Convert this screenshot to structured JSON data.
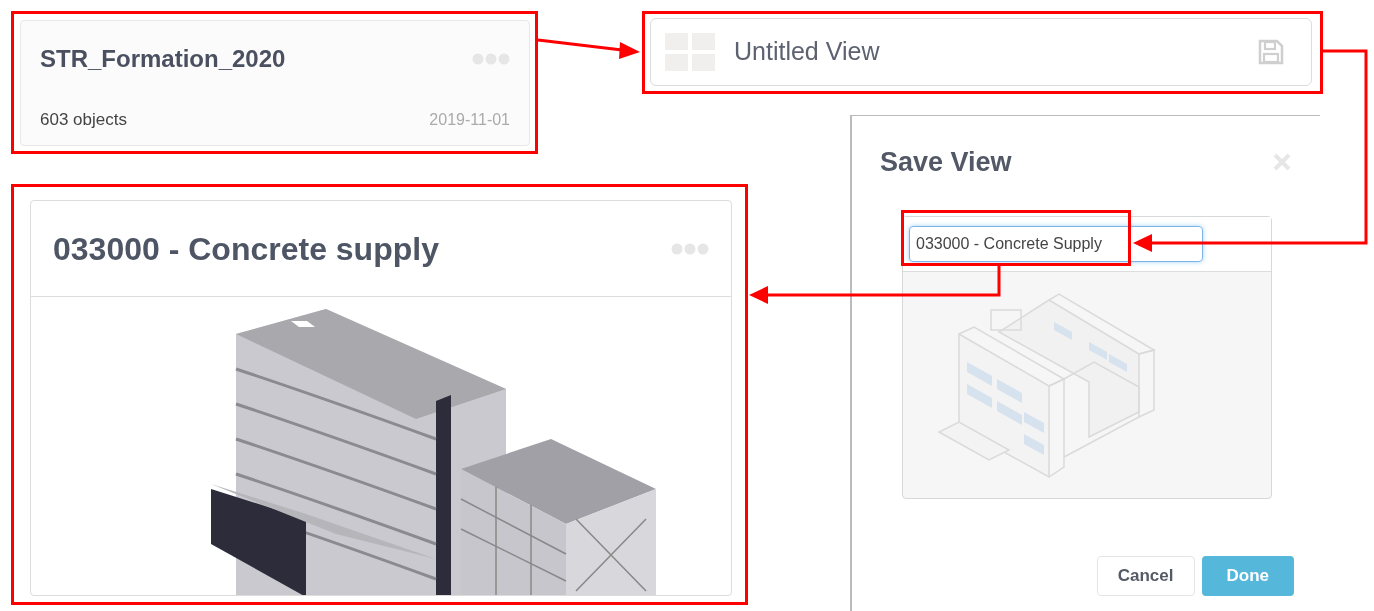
{
  "model_card": {
    "title": "STR_Formation_2020",
    "object_count": "603 objects",
    "date": "2019-11-01"
  },
  "view_bar": {
    "title": "Untitled View"
  },
  "save_dialog": {
    "title": "Save View",
    "name_field": {
      "value": "033000 - Concrete Supply"
    },
    "buttons": [
      {
        "label": "Cancel",
        "kind": "secondary"
      },
      {
        "label": "Done",
        "kind": "primary"
      }
    ]
  },
  "view_card": {
    "title": "033000 - Concrete supply"
  }
}
